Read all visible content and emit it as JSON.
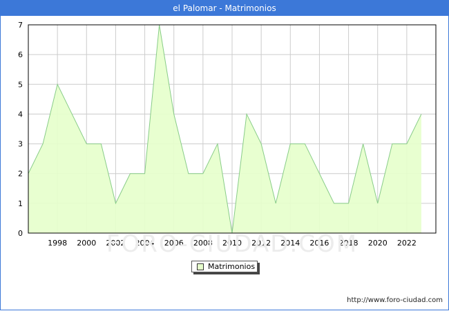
{
  "header": {
    "title": "el Palomar - Matrimonios"
  },
  "footer": {
    "url": "http://www.foro-ciudad.com"
  },
  "watermark": "FORO-CIUDAD.COM",
  "colors": {
    "title_bar": "#3c78d8",
    "area_fill": "#e6ffcc",
    "area_line": "#88cc88",
    "grid": "#cccccc"
  },
  "chart_data": {
    "type": "area",
    "title": "el Palomar - Matrimonios",
    "xlabel": "",
    "ylabel": "",
    "x": [
      1996,
      1997,
      1998,
      1999,
      2000,
      2001,
      2002,
      2003,
      2004,
      2005,
      2006,
      2007,
      2008,
      2009,
      2010,
      2011,
      2012,
      2013,
      2014,
      2015,
      2016,
      2017,
      2018,
      2019,
      2020,
      2021,
      2022,
      2023
    ],
    "series": [
      {
        "name": "Matrimonios",
        "values": [
          2,
          3,
          5,
          4,
          3,
          3,
          1,
          2,
          2,
          7,
          4,
          2,
          2,
          3,
          0,
          4,
          3,
          1,
          3,
          3,
          2,
          1,
          1,
          3,
          1,
          3,
          3,
          4
        ]
      }
    ],
    "xticks": [
      "1998",
      "2000",
      "2002",
      "2004",
      "2006",
      "2008",
      "2010",
      "2012",
      "2014",
      "2016",
      "2018",
      "2020",
      "2022"
    ],
    "yticks": [
      "0",
      "1",
      "2",
      "3",
      "4",
      "5",
      "6",
      "7"
    ],
    "xlim": [
      1996,
      2024
    ],
    "ylim": [
      0,
      7
    ],
    "grid": true,
    "legend_position": "bottom-center"
  }
}
